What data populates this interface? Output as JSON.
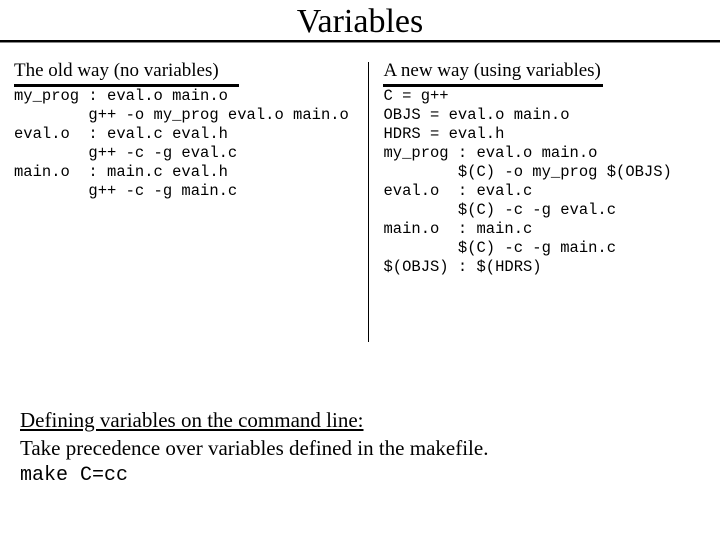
{
  "title": "Variables",
  "left": {
    "heading": "The old way (no variables)",
    "code": "my_prog : eval.o main.o\n        g++ -o my_prog eval.o main.o\neval.o  : eval.c eval.h\n        g++ -c -g eval.c\nmain.o  : main.c eval.h\n        g++ -c -g main.c"
  },
  "right": {
    "heading": "A new way (using variables)",
    "vars": "C = g++\nOBJS = eval.o main.o\nHDRS = eval.h",
    "code": "my_prog : eval.o main.o\n        $(C) -o my_prog $(OBJS)\neval.o  : eval.c\n        $(C) -c -g eval.c\nmain.o  : main.c\n        $(C) -c -g main.c\n$(OBJS) : $(HDRS)"
  },
  "bottom": {
    "line1": "Defining variables on the command line:",
    "line2": "Take precedence over variables defined in the makefile.",
    "cmd": "make C=cc"
  }
}
